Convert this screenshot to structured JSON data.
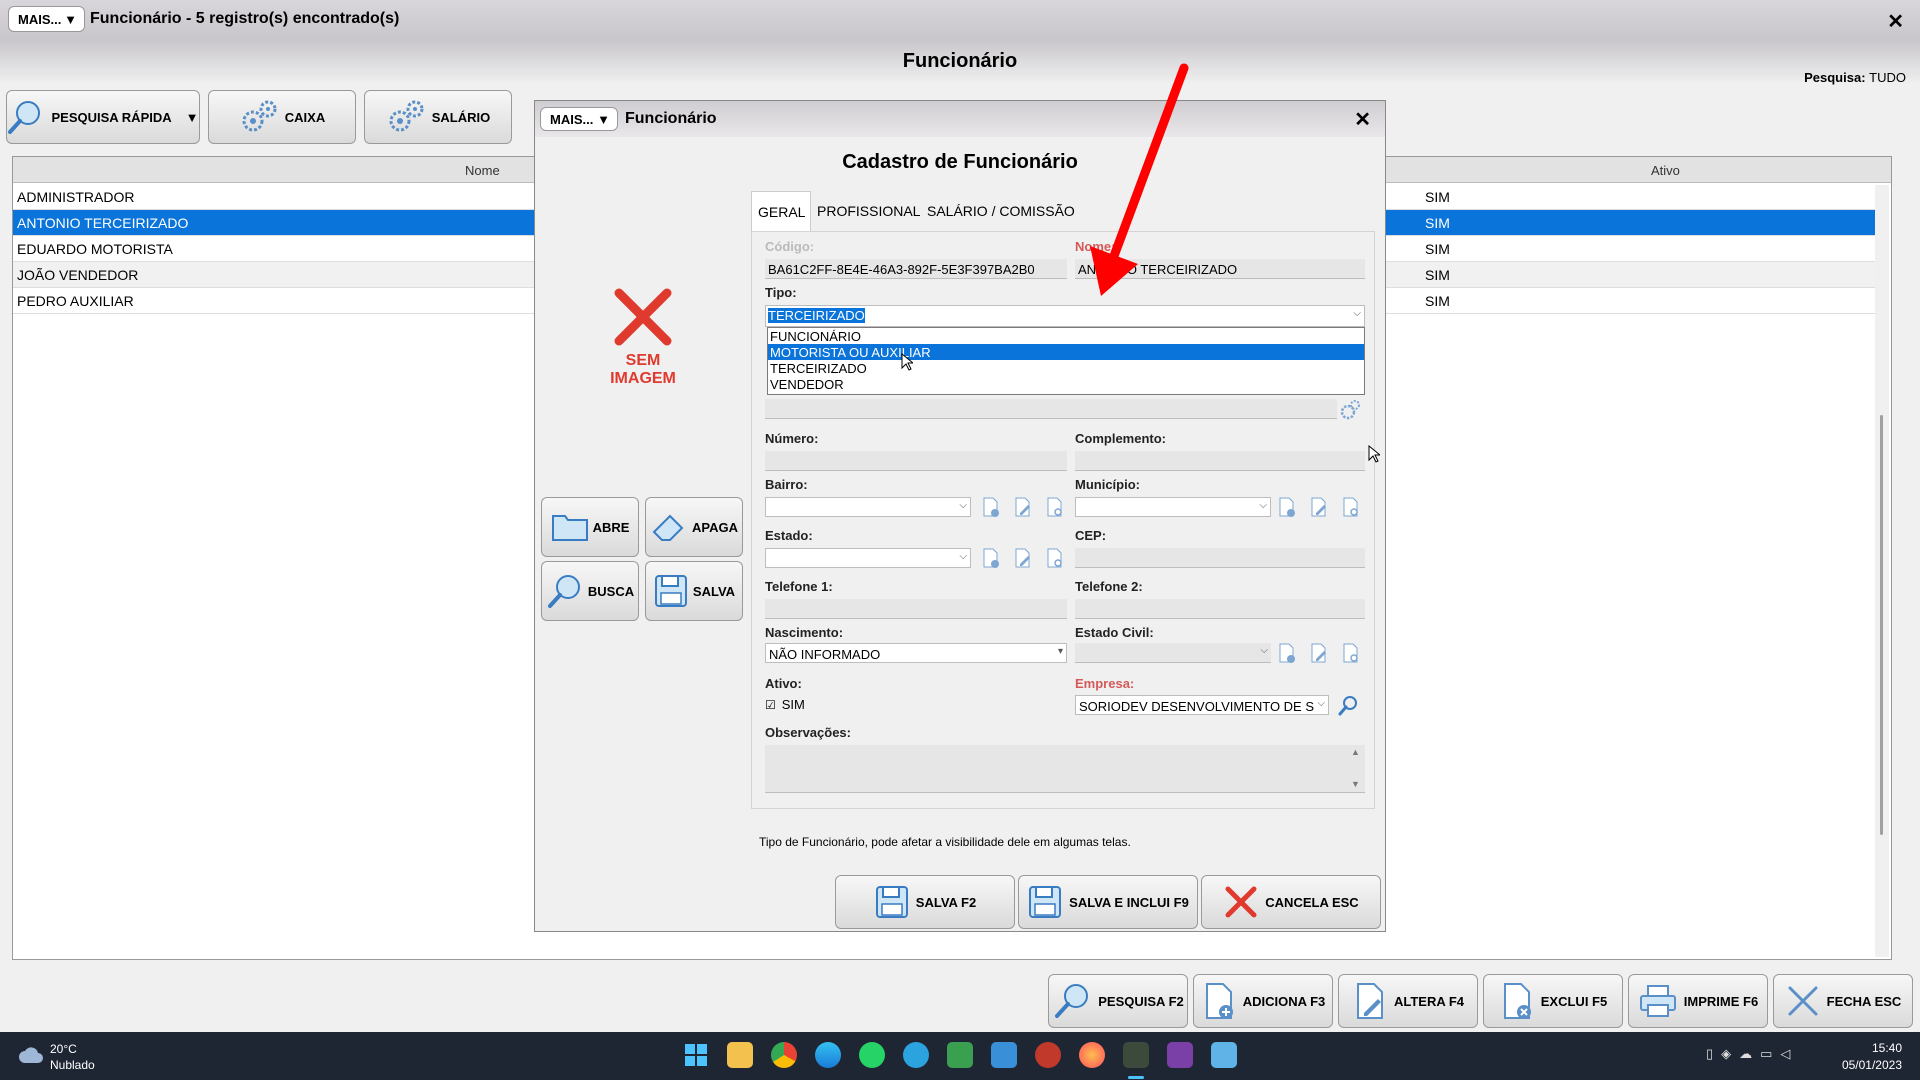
{
  "window": {
    "mais_label": "MAIS...",
    "title": "Funcionário - 5 registro(s) encontrado(s)",
    "page_title": "Funcionário",
    "pesquisa_label": "Pesquisa:",
    "pesquisa_value": "TUDO"
  },
  "toolbar": {
    "pesquisa_rapida": "PESQUISA RÁPIDA",
    "caixa": "CAIXA",
    "salario": "SALÁRIO"
  },
  "grid": {
    "columns": [
      "Nome",
      "Ativo"
    ],
    "rows": [
      {
        "nome": "ADMINISTRADOR",
        "ativo": "SIM"
      },
      {
        "nome": "ANTONIO TERCEIRIZADO",
        "ativo": "SIM"
      },
      {
        "nome": "EDUARDO MOTORISTA",
        "ativo": "SIM"
      },
      {
        "nome": "JOÃO VENDEDOR",
        "ativo": "SIM"
      },
      {
        "nome": "PEDRO AUXILIAR",
        "ativo": "SIM"
      }
    ],
    "selected_row": 1
  },
  "bottom_toolbar": {
    "pesquisa": "PESQUISA F2",
    "adiciona": "ADICIONA F3",
    "altera": "ALTERA F4",
    "exclui": "EXCLUI F5",
    "imprime": "IMPRIME F6",
    "fecha": "FECHA ESC"
  },
  "dialog": {
    "mais_label": "MAIS...",
    "title": "Funcionário",
    "heading": "Cadastro de Funcionário",
    "no_image_line1": "SEM",
    "no_image_line2": "IMAGEM",
    "side_buttons": {
      "abre": "ABRE",
      "apaga": "APAGA",
      "busca": "BUSCA",
      "salva": "SALVA"
    },
    "tabs": [
      "GERAL",
      "PROFISSIONAL",
      "SALÁRIO / COMISSÃO"
    ],
    "fields": {
      "codigo_label": "Código:",
      "codigo_value": "BA61C2FF-8E4E-46A3-892F-5E3F397BA2B0",
      "nome_label": "Nome:",
      "nome_value": "ANTONIO TERCEIRIZADO",
      "tipo_label": "Tipo:",
      "tipo_value": "TERCEIRIZADO",
      "tipo_options": [
        "FUNCIONÁRIO",
        "MOTORISTA OU AUXILIAR",
        "TERCEIRIZADO",
        "VENDEDOR"
      ],
      "tipo_highlighted": 1,
      "numero_label": "Número:",
      "complemento_label": "Complemento:",
      "bairro_label": "Bairro:",
      "municipio_label": "Município:",
      "estado_label": "Estado:",
      "cep_label": "CEP:",
      "telefone1_label": "Telefone 1:",
      "telefone2_label": "Telefone 2:",
      "nascimento_label": "Nascimento:",
      "nascimento_value": "NÃO INFORMADO",
      "estado_civil_label": "Estado Civil:",
      "ativo_label": "Ativo:",
      "ativo_value": "SIM",
      "empresa_label": "Empresa:",
      "empresa_value": "SORIODEV DESENVOLVIMENTO DE S",
      "observacoes_label": "Observações:"
    },
    "hint": "Tipo de Funcionário, pode afetar a visibilidade dele em algumas telas.",
    "buttons": {
      "salva": "SALVA F2",
      "salva_inclui": "SALVA E INCLUI F9",
      "cancela": "CANCELA ESC"
    }
  },
  "taskbar": {
    "weather_temp": "20°C",
    "weather_desc": "Nublado",
    "time": "15:40",
    "date": "05/01/2023"
  },
  "colors": {
    "selection": "#0a74da",
    "annotation_arrow": "#ff0000",
    "no_image_red": "#e03a2f"
  }
}
